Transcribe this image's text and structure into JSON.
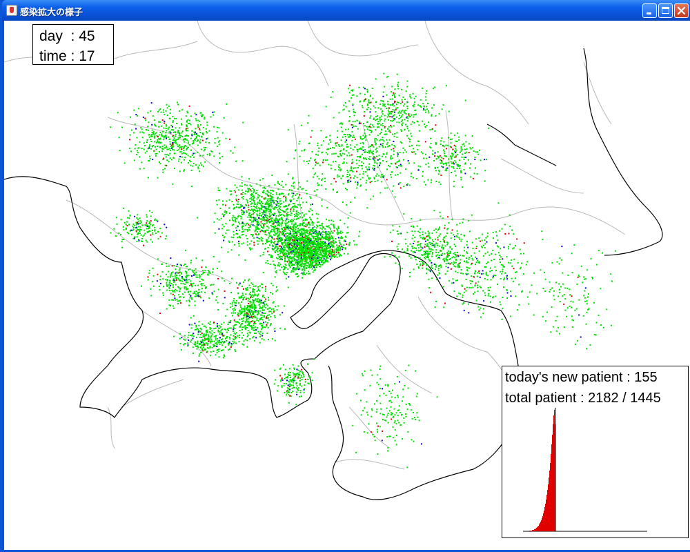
{
  "window": {
    "title": "感染拡大の様子",
    "buttons": {
      "minimize": "minimize",
      "maximize": "maximize",
      "close": "close"
    }
  },
  "sim": {
    "day_label": "day",
    "day_value": "45",
    "time_label": "time",
    "time_value": "17"
  },
  "stats": {
    "new_label": "today's new patient",
    "new_value": "155",
    "total_label": "total patient",
    "total_value": "2182 / 1445"
  },
  "legend_colors": {
    "susceptible": "#00e000",
    "infected": "#e00000",
    "recovered": "#0000d0",
    "coast": "#000000",
    "border": "#b0b0b0"
  },
  "chart_data": {
    "type": "bar",
    "series": [
      {
        "name": "",
        "values": [
          0,
          0,
          0,
          0,
          0,
          0,
          0,
          0,
          0,
          1,
          1,
          1,
          1,
          2,
          2,
          2,
          3,
          3,
          4,
          5,
          6,
          7,
          8,
          10,
          12,
          14,
          16,
          19,
          22,
          26,
          30,
          35,
          40,
          46,
          53,
          60,
          68,
          78,
          88,
          99,
          112,
          126,
          140,
          155,
          168,
          176,
          155
        ]
      }
    ],
    "ylim": [
      0,
      180
    ],
    "grid": false
  }
}
